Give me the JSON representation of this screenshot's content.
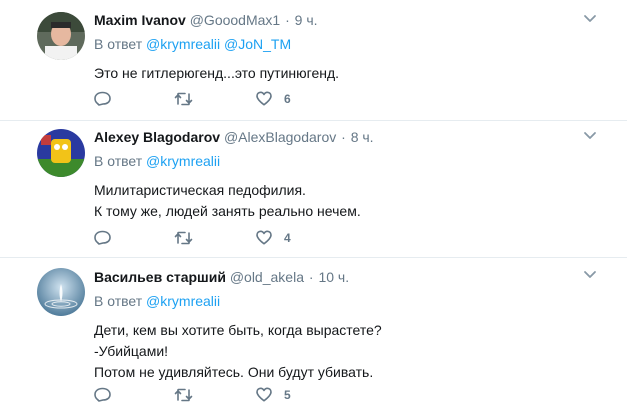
{
  "tweets": [
    {
      "name": "Maxim Ivanov",
      "handle": "@GooodMax1",
      "time": "9 ч.",
      "reply_prefix": "В ответ",
      "mentions": [
        "@krymrealii",
        "@JoN_TM"
      ],
      "text_lines": [
        "Это не гитлерюгенд...это путинюгенд."
      ],
      "likes": "6"
    },
    {
      "name": "Alexey Blagodarov",
      "handle": "@AlexBlagodarov",
      "time": "8 ч.",
      "reply_prefix": "В ответ",
      "mentions": [
        "@krymrealii"
      ],
      "text_lines": [
        "Милитаристическая педофилия.",
        "К тому же, людей занять реально нечем."
      ],
      "likes": "4"
    },
    {
      "name": "Васильев старший",
      "handle": "@old_akela",
      "time": "10 ч.",
      "reply_prefix": "В ответ",
      "mentions": [
        "@krymrealii"
      ],
      "text_lines": [
        "Дети, кем вы хотите быть, когда вырастете?",
        "-Убийцами!",
        "Потом не удивляйтесь. Они будут убивать."
      ],
      "likes": "5"
    }
  ],
  "icons": {
    "reply": "reply-icon",
    "retweet": "retweet-icon",
    "like": "heart-icon",
    "menu": "chevron-down-icon"
  },
  "colors": {
    "link": "#1da1f2",
    "muted": "#657786",
    "text": "#14171a"
  }
}
